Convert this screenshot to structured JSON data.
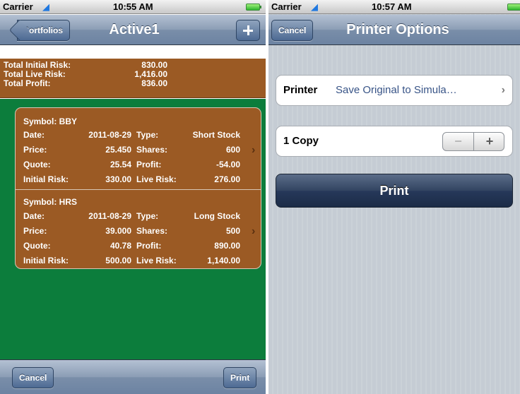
{
  "left": {
    "status": {
      "carrier": "Carrier",
      "wifi_icon": "wifi-icon",
      "time": "10:55 AM",
      "battery_icon": "battery-icon"
    },
    "nav": {
      "back_label": "Portfolios",
      "title": "Active1",
      "add_icon": "plus-icon"
    },
    "summary": [
      {
        "label": "Total Initial Risk:",
        "value": "830.00"
      },
      {
        "label": "Total Live Risk:",
        "value": "1,416.00"
      },
      {
        "label": "Total Profit:",
        "value": "836.00"
      }
    ],
    "trades": [
      {
        "symbol": "Symbol: BBY",
        "date_label": "Date:",
        "date": "2011-08-29",
        "type_label": "Type:",
        "type": "Short Stock",
        "price_label": "Price:",
        "price": "25.450",
        "shares_label": "Shares:",
        "shares": "600",
        "quote_label": "Quote:",
        "quote": "25.54",
        "profit_label": "Profit:",
        "profit": "-54.00",
        "initial_risk_label": "Initial Risk:",
        "initial_risk": "330.00",
        "live_risk_label": "Live Risk:",
        "live_risk": "276.00"
      },
      {
        "symbol": "Symbol: HRS",
        "date_label": "Date:",
        "date": "2011-08-29",
        "type_label": "Type:",
        "type": "Long Stock",
        "price_label": "Price:",
        "price": "39.000",
        "shares_label": "Shares:",
        "shares": "500",
        "quote_label": "Quote:",
        "quote": "40.78",
        "profit_label": "Profit:",
        "profit": "890.00",
        "initial_risk_label": "Initial Risk:",
        "initial_risk": "500.00",
        "live_risk_label": "Live Risk:",
        "live_risk": "1,140.00"
      }
    ],
    "toolbar": {
      "cancel_label": "Cancel",
      "print_label": "Print"
    }
  },
  "right": {
    "status": {
      "carrier": "Carrier",
      "time": "10:57 AM"
    },
    "nav": {
      "cancel_label": "Cancel",
      "title": "Printer Options"
    },
    "printer": {
      "label": "Printer",
      "value": "Save Original to Simula…"
    },
    "copies": {
      "label": "1 Copy",
      "minus": "−",
      "plus": "+"
    },
    "print_button": "Print"
  },
  "colors": {
    "brown_panel": "#9b5a24",
    "green_background": "#0c7d3c",
    "navbar_blue": "#6c83a2",
    "print_button_dark": "#26385a"
  }
}
